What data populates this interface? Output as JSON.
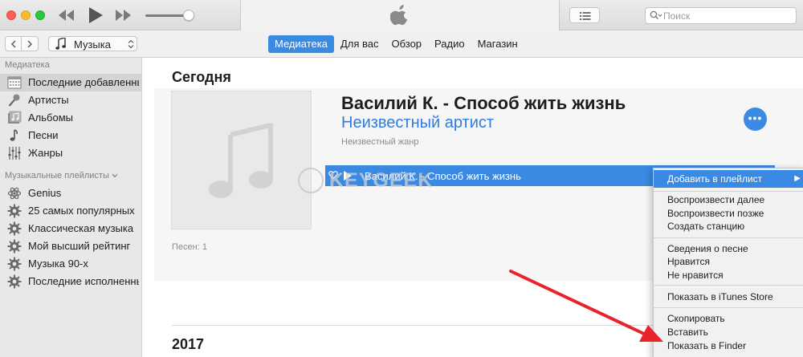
{
  "window": {
    "search_placeholder": "Поиск"
  },
  "nav": {
    "media_label": "Музыка",
    "tabs": [
      {
        "label": "Медиатека",
        "active": true
      },
      {
        "label": "Для вас",
        "active": false
      },
      {
        "label": "Обзор",
        "active": false
      },
      {
        "label": "Радио",
        "active": false
      },
      {
        "label": "Магазин",
        "active": false
      }
    ]
  },
  "sidebar": {
    "library_heading": "Медиатека",
    "library_items": [
      {
        "label": "Последние добавленные",
        "icon": "recently-added-icon",
        "selected": true
      },
      {
        "label": "Артисты",
        "icon": "microphone-icon",
        "selected": false
      },
      {
        "label": "Альбомы",
        "icon": "album-icon",
        "selected": false
      },
      {
        "label": "Песни",
        "icon": "music-note-icon",
        "selected": false
      },
      {
        "label": "Жанры",
        "icon": "genres-icon",
        "selected": false
      }
    ],
    "playlists_heading": "Музыкальные плейлисты",
    "playlists": [
      {
        "label": "Genius",
        "icon": "atom-icon"
      },
      {
        "label": "25 самых популярных",
        "icon": "gear-icon"
      },
      {
        "label": "Классическая музыка",
        "icon": "gear-icon"
      },
      {
        "label": "Мой высший рейтинг",
        "icon": "gear-icon"
      },
      {
        "label": "Музыка 90-х",
        "icon": "gear-icon"
      },
      {
        "label": "Последние исполненные",
        "icon": "gear-icon"
      }
    ]
  },
  "main": {
    "section_today": "Сегодня",
    "album": {
      "title": "Василий К. - Способ жить жизнь",
      "artist": "Неизвестный артист",
      "genre": "Неизвестный жанр",
      "track_title": "Василий К. - Способ жить жизнь",
      "songs_count": "Песен: 1"
    },
    "watermark": "KEYGEEK",
    "section_year": "2017"
  },
  "context_menu": {
    "items": [
      {
        "label": "Добавить в плейлист",
        "submenu": true,
        "highlighted": true
      },
      {
        "label": "Воспроизвести далее"
      },
      {
        "label": "Воспроизвести позже"
      },
      {
        "label": "Создать станцию"
      },
      {
        "label": "Сведения о песне"
      },
      {
        "label": "Нравится"
      },
      {
        "label": "Не нравится"
      },
      {
        "label": "Показать в iTunes Store"
      },
      {
        "label": "Скопировать"
      },
      {
        "label": "Вставить"
      },
      {
        "label": "Показать в Finder"
      }
    ],
    "submenu_arrow": "▶"
  },
  "colors": {
    "accent": "#3a89e3",
    "annotation_arrow": "#e8232b"
  }
}
